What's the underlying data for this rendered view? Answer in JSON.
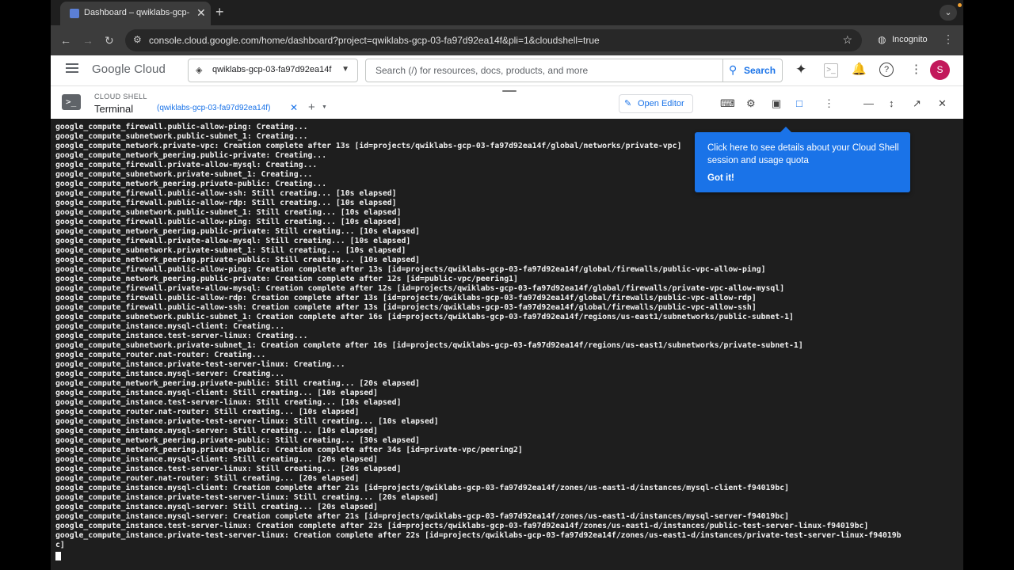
{
  "browser": {
    "tab_title": "Dashboard – qwiklabs-gcp-",
    "tab_close": "✕",
    "new_tab": "+",
    "url": "console.cloud.google.com/home/dashboard?project=qwiklabs-gcp-03-fa97d92ea14f&pli=1&cloudshell=true",
    "incognito_label": "Incognito",
    "accent_color": "#3c3c3c"
  },
  "header": {
    "logo_text": "Google Cloud",
    "project": "qwiklabs-gcp-03-fa97d92ea14f",
    "search_placeholder": "Search (/) for resources, docs, products, and more",
    "search_button": "Search",
    "avatar_initial": "S",
    "avatar_color": "#c2185b"
  },
  "cloud_shell": {
    "subtitle": "CLOUD SHELL",
    "title": "Terminal",
    "tab_label": "(qwiklabs-gcp-03-fa97d92ea14f)",
    "open_editor": "Open Editor"
  },
  "tooltip": {
    "text": "Click here to see details about your Cloud Shell session and usage quota",
    "action": "Got it!"
  },
  "terminal": {
    "lines": [
      "google_compute_firewall.public-allow-ping: Creating...",
      "google_compute_subnetwork.public-subnet_1: Creating...",
      "google_compute_network.private-vpc: Creation complete after 13s [id=projects/qwiklabs-gcp-03-fa97d92ea14f/global/networks/private-vpc]",
      "google_compute_network_peering.public-private: Creating...",
      "google_compute_firewall.private-allow-mysql: Creating...",
      "google_compute_subnetwork.private-subnet_1: Creating...",
      "google_compute_network_peering.private-public: Creating...",
      "google_compute_firewall.public-allow-ssh: Still creating... [10s elapsed]",
      "google_compute_firewall.public-allow-rdp: Still creating... [10s elapsed]",
      "google_compute_subnetwork.public-subnet_1: Still creating... [10s elapsed]",
      "google_compute_firewall.public-allow-ping: Still creating... [10s elapsed]",
      "google_compute_network_peering.public-private: Still creating... [10s elapsed]",
      "google_compute_firewall.private-allow-mysql: Still creating... [10s elapsed]",
      "google_compute_subnetwork.private-subnet_1: Still creating... [10s elapsed]",
      "google_compute_network_peering.private-public: Still creating... [10s elapsed]",
      "google_compute_firewall.public-allow-ping: Creation complete after 13s [id=projects/qwiklabs-gcp-03-fa97d92ea14f/global/firewalls/public-vpc-allow-ping]",
      "google_compute_network_peering.public-private: Creation complete after 12s [id=public-vpc/peering1]",
      "google_compute_firewall.private-allow-mysql: Creation complete after 12s [id=projects/qwiklabs-gcp-03-fa97d92ea14f/global/firewalls/private-vpc-allow-mysql]",
      "google_compute_firewall.public-allow-rdp: Creation complete after 13s [id=projects/qwiklabs-gcp-03-fa97d92ea14f/global/firewalls/public-vpc-allow-rdp]",
      "google_compute_firewall.public-allow-ssh: Creation complete after 13s [id=projects/qwiklabs-gcp-03-fa97d92ea14f/global/firewalls/public-vpc-allow-ssh]",
      "google_compute_subnetwork.public-subnet_1: Creation complete after 16s [id=projects/qwiklabs-gcp-03-fa97d92ea14f/regions/us-east1/subnetworks/public-subnet-1]",
      "google_compute_instance.mysql-client: Creating...",
      "google_compute_instance.test-server-linux: Creating...",
      "google_compute_subnetwork.private-subnet_1: Creation complete after 16s [id=projects/qwiklabs-gcp-03-fa97d92ea14f/regions/us-east1/subnetworks/private-subnet-1]",
      "google_compute_router.nat-router: Creating...",
      "google_compute_instance.private-test-server-linux: Creating...",
      "google_compute_instance.mysql-server: Creating...",
      "google_compute_network_peering.private-public: Still creating... [20s elapsed]",
      "google_compute_instance.mysql-client: Still creating... [10s elapsed]",
      "google_compute_instance.test-server-linux: Still creating... [10s elapsed]",
      "google_compute_router.nat-router: Still creating... [10s elapsed]",
      "google_compute_instance.private-test-server-linux: Still creating... [10s elapsed]",
      "google_compute_instance.mysql-server: Still creating... [10s elapsed]",
      "google_compute_network_peering.private-public: Still creating... [30s elapsed]",
      "google_compute_network_peering.private-public: Creation complete after 34s [id=private-vpc/peering2]",
      "google_compute_instance.mysql-client: Still creating... [20s elapsed]",
      "google_compute_instance.test-server-linux: Still creating... [20s elapsed]",
      "google_compute_router.nat-router: Still creating... [20s elapsed]",
      "google_compute_instance.mysql-client: Creation complete after 21s [id=projects/qwiklabs-gcp-03-fa97d92ea14f/zones/us-east1-d/instances/mysql-client-f94019bc]",
      "google_compute_instance.private-test-server-linux: Still creating... [20s elapsed]",
      "google_compute_instance.mysql-server: Still creating... [20s elapsed]",
      "google_compute_instance.mysql-server: Creation complete after 21s [id=projects/qwiklabs-gcp-03-fa97d92ea14f/zones/us-east1-d/instances/mysql-server-f94019bc]",
      "google_compute_instance.test-server-linux: Creation complete after 22s [id=projects/qwiklabs-gcp-03-fa97d92ea14f/zones/us-east1-d/instances/public-test-server-linux-f94019bc]",
      "google_compute_instance.private-test-server-linux: Creation complete after 22s [id=projects/qwiklabs-gcp-03-fa97d92ea14f/zones/us-east1-d/instances/private-test-server-linux-f94019b",
      "c]"
    ]
  }
}
